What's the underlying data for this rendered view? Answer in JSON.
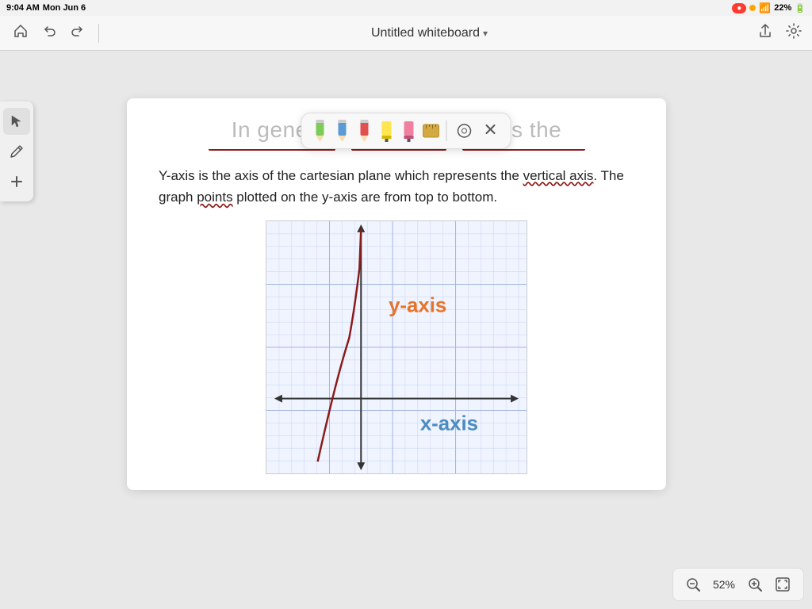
{
  "status_bar": {
    "time": "9:04 AM",
    "day": "Mon Jun 6",
    "battery_percent": "22%"
  },
  "nav": {
    "title": "Untitled whiteboard",
    "home_label": "⌂",
    "undo_label": "↩",
    "redo_label": "↪",
    "share_label": "↑",
    "settings_label": "⚙"
  },
  "pencil_toolbar": {
    "close_label": "×",
    "circle_label": "○"
  },
  "content": {
    "title": "In general, y-axis represents the",
    "body": "Y-axis is the axis of the cartesian plane which represents the vertical axis. The graph points plotted on the y-axis are from top to bottom.",
    "graph": {
      "y_label": "y-axis",
      "x_label": "x-axis"
    }
  },
  "bottom_toolbar": {
    "zoom_out_label": "−",
    "zoom_in_label": "+",
    "zoom_level": "52%",
    "fit_label": "⊡"
  },
  "tools": {
    "select_icon": "↖",
    "pen_icon": "✏",
    "add_icon": "+"
  }
}
